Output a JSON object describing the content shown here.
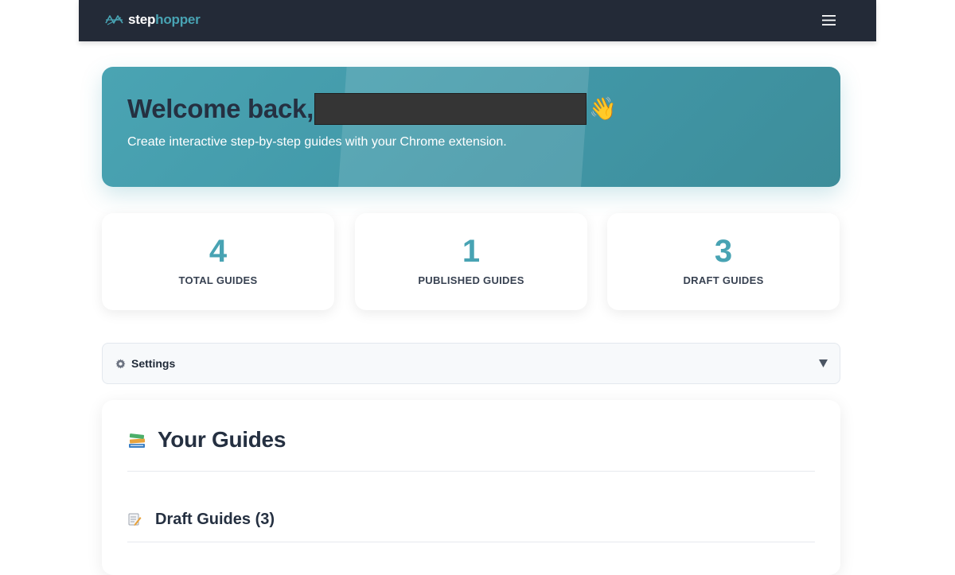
{
  "brand": {
    "name_part1": "step",
    "name_part2": "hopper",
    "colors": {
      "accent": "#48a3b3",
      "nav_bg": "#232a37"
    }
  },
  "nav": {
    "menu_icon": "hamburger-menu-icon"
  },
  "hero": {
    "title": "Welcome back,",
    "emoji": "👋",
    "subtitle": "Create interactive step-by-step guides with your Chrome extension."
  },
  "stats": [
    {
      "value": "4",
      "label": "TOTAL GUIDES"
    },
    {
      "value": "1",
      "label": "PUBLISHED GUIDES"
    },
    {
      "value": "3",
      "label": "DRAFT GUIDES"
    }
  ],
  "settings": {
    "icon": "gear-icon",
    "label": "Settings",
    "chevron_icon": "caret-down-icon"
  },
  "guides": {
    "icon": "books-icon",
    "title": "Your Guides",
    "draft_section": {
      "icon": "memo-icon",
      "title": "Draft Guides (3)"
    }
  }
}
